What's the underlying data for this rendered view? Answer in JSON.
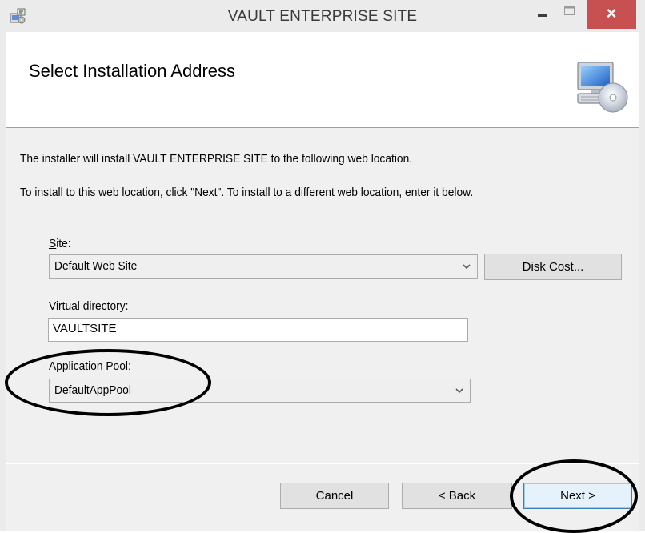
{
  "window": {
    "title": "VAULT ENTERPRISE SITE",
    "min_symbol": "–",
    "max_symbol": "□",
    "close_symbol": "×"
  },
  "header": {
    "title": "Select Installation Address"
  },
  "content": {
    "intro_line1": "The installer will install VAULT ENTERPRISE SITE to the following web location.",
    "intro_line2": "To install to this web location, click \"Next\". To install to a different web location, enter it below.",
    "site": {
      "label_accel": "S",
      "label_rest": "ite:",
      "value": "Default Web Site"
    },
    "disk_cost_label": "Disk Cost...",
    "virtual_directory": {
      "label_accel": "V",
      "label_rest": "irtual directory:",
      "value": "VAULTSITE"
    },
    "application_pool": {
      "label_accel": "A",
      "label_rest": "pplication Pool:",
      "value": "DefaultAppPool"
    }
  },
  "footer": {
    "cancel_label": "Cancel",
    "back_label": "< Back",
    "next_label": "Next >"
  }
}
